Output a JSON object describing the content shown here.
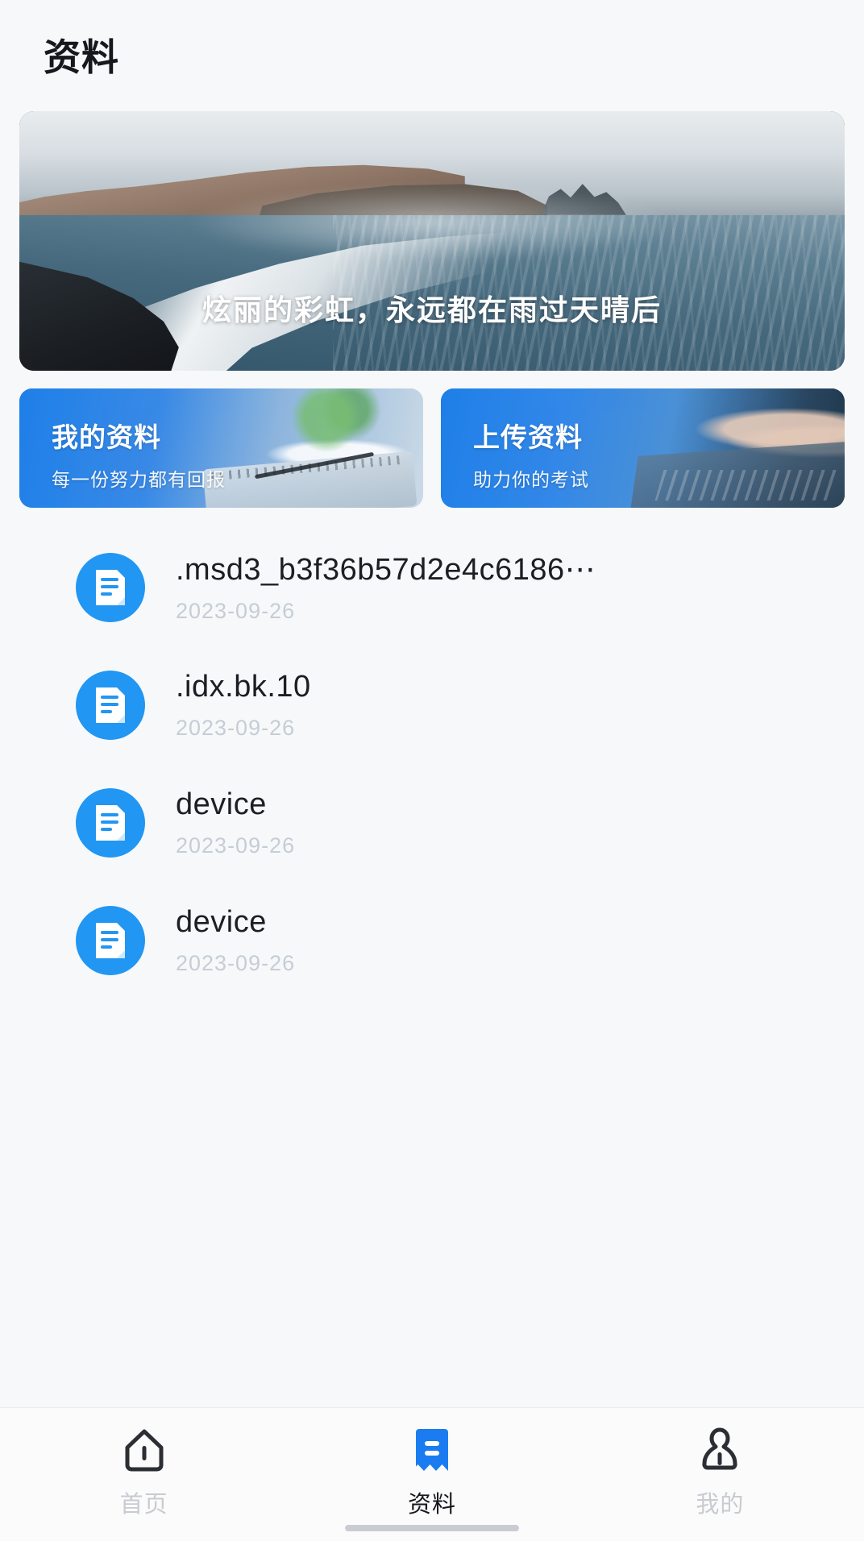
{
  "app": {
    "page_title": "资料",
    "accent_color": "#2196f3",
    "background_color": "#f7f8f9"
  },
  "hero": {
    "name": "hero-banner",
    "caption": "炫丽的彩虹，永远都在雨过天晴后",
    "image_description": "black sand beach with sea stacks and misty cliff"
  },
  "feature_cards": [
    {
      "title": "我的资料",
      "subtitle": "每一份努力都有回报",
      "icon": "desk-plant-notebook-photo"
    },
    {
      "title": "上传资料",
      "subtitle": "助力你的考试",
      "icon": "hands-typing-laptop-photo"
    }
  ],
  "files": {
    "icon": "document-icon",
    "items": [
      {
        "name": ".msd3_b3f36b57d2e4c6186⋯",
        "date": "2023-09-26"
      },
      {
        "name": ".idx.bk.10",
        "date": "2023-09-26"
      },
      {
        "name": "device",
        "date": "2023-09-26"
      },
      {
        "name": "device",
        "date": "2023-09-26"
      }
    ]
  },
  "tabbar": {
    "items": [
      {
        "label": "首页",
        "icon": "home-icon",
        "active": false
      },
      {
        "label": "资料",
        "icon": "bookmark-document-icon",
        "active": true
      },
      {
        "label": "我的",
        "icon": "person-icon",
        "active": false
      }
    ]
  }
}
